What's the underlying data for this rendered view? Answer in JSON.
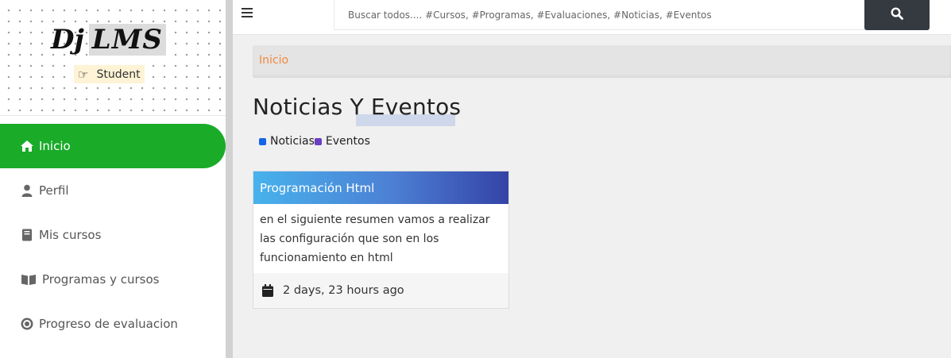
{
  "brand": {
    "logo_prefix": "Dj",
    "logo_highlight": "LMS",
    "role": "Student"
  },
  "sidebar": {
    "items": [
      {
        "label": "Inicio",
        "icon": "home-icon",
        "active": true
      },
      {
        "label": "Perfil",
        "icon": "user-icon",
        "active": false
      },
      {
        "label": "Mis cursos",
        "icon": "book-icon",
        "active": false
      },
      {
        "label": "Programas y cursos",
        "icon": "book-open-icon",
        "active": false
      },
      {
        "label": "Progreso de evaluacion",
        "icon": "dot-circle-icon",
        "active": false
      }
    ]
  },
  "search": {
    "placeholder": "Buscar todos.... #Cursos, #Programas, #Evaluaciones, #Noticias, #Eventos"
  },
  "breadcrumb": {
    "home": "Inicio"
  },
  "main": {
    "title": "Noticias Y Eventos",
    "legend": [
      {
        "label": "Noticias",
        "color": "#1565e6"
      },
      {
        "label": "Eventos",
        "color": "#6a3fc4"
      }
    ]
  },
  "card": {
    "title": "Programación Html",
    "body": "en el siguiente resumen vamos a realizar las configuración que son en los funcionamiento en html",
    "date": "2 days, 23 hours ago"
  },
  "colors": {
    "accent": "#1aab29",
    "breadcrumb_link": "#f08a3c",
    "search_button": "#343a40"
  }
}
